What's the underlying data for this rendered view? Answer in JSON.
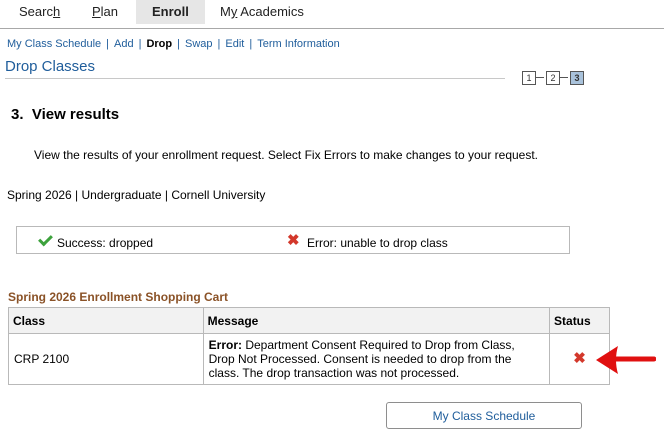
{
  "tabs": [
    {
      "label_pre": "Searc",
      "label_ul": "h",
      "label_post": ""
    },
    {
      "label_pre": "",
      "label_ul": "P",
      "label_post": "lan"
    },
    {
      "label": "Enroll"
    },
    {
      "label_pre": "M",
      "label_ul": "y",
      "label_post": " Academics"
    }
  ],
  "subnav": {
    "my_class_schedule": "My Class Schedule",
    "add": "Add",
    "drop": "Drop",
    "swap": "Swap",
    "edit": "Edit",
    "term_information": "Term Information",
    "separator": "|"
  },
  "page_title": "Drop Classes",
  "steps": [
    "1",
    "2",
    "3"
  ],
  "step_heading": "3.  View results",
  "instructions": "View the results of your enrollment request.  Select Fix Errors to make changes to your request.",
  "term_info": "Spring 2026 | Undergraduate | Cornell University",
  "legend": {
    "success": "Success: dropped",
    "error": "Error: unable to drop class"
  },
  "cart": {
    "title": "Spring 2026 Enrollment Shopping Cart",
    "headers": {
      "class": "Class",
      "message": "Message",
      "status": "Status"
    },
    "rows": [
      {
        "class": "CRP 2100",
        "message_bold": "Error:",
        "message_rest": " Department Consent Required to Drop from Class, Drop Not Processed. Consent is needed to drop from the class. The drop transaction was not processed.",
        "status_icon": "error-x-icon"
      }
    ]
  },
  "button": {
    "my_class_schedule": "My Class Schedule"
  },
  "colors": {
    "link": "#1f5d9b",
    "success": "#3da23d",
    "error": "#d3382b",
    "cart_title": "#8a5227",
    "arrow": "#e01010"
  }
}
